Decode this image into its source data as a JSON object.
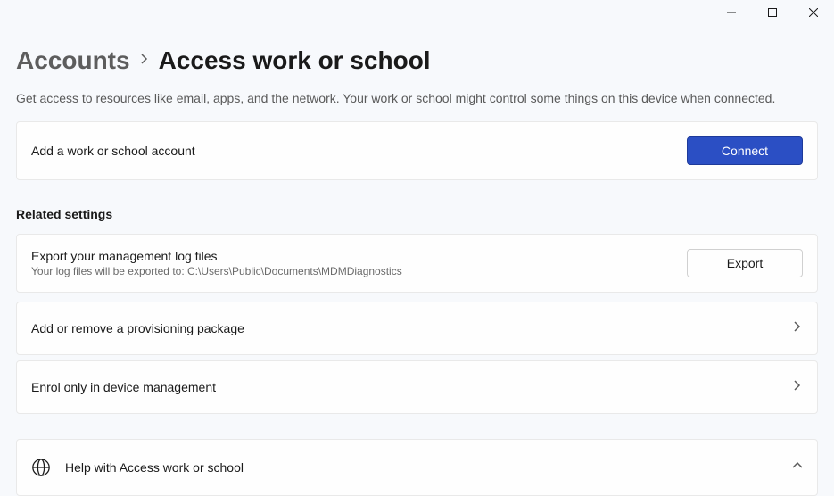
{
  "breadcrumb": {
    "parent": "Accounts",
    "current": "Access work or school"
  },
  "subtitle": "Get access to resources like email, apps, and the network. Your work or school might control some things on this device when connected.",
  "add_account": {
    "label": "Add a work or school account",
    "button": "Connect"
  },
  "related": {
    "heading": "Related settings",
    "export": {
      "title": "Export your management log files",
      "subtitle": "Your log files will be exported to: C:\\Users\\Public\\Documents\\MDMDiagnostics",
      "button": "Export"
    },
    "provisioning": "Add or remove a provisioning package",
    "enrol": "Enrol only in device management"
  },
  "help": {
    "label": "Help with Access work or school"
  }
}
